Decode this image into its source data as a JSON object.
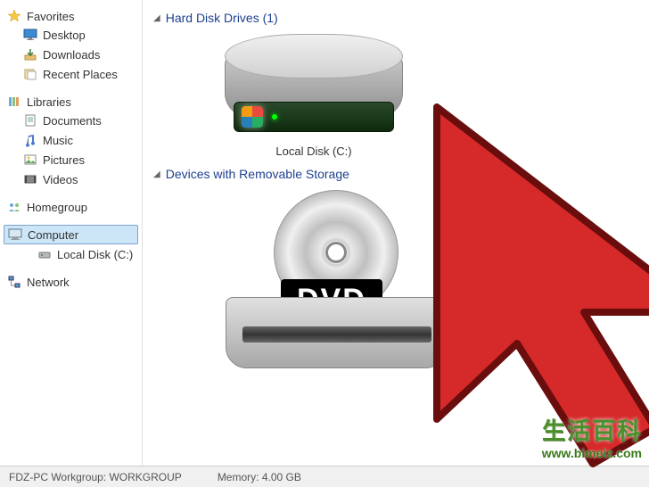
{
  "sidebar": {
    "favorites": {
      "label": "Favorites",
      "items": [
        {
          "label": "Desktop"
        },
        {
          "label": "Downloads"
        },
        {
          "label": "Recent Places"
        }
      ]
    },
    "libraries": {
      "label": "Libraries",
      "items": [
        {
          "label": "Documents"
        },
        {
          "label": "Music"
        },
        {
          "label": "Pictures"
        },
        {
          "label": "Videos"
        }
      ]
    },
    "homegroup": {
      "label": "Homegroup"
    },
    "computer": {
      "label": "Computer",
      "items": [
        {
          "label": "Local Disk (C:)"
        }
      ]
    },
    "network": {
      "label": "Network"
    }
  },
  "content": {
    "hdd_section": "Hard Disk Drives (1)",
    "local_disk_label": "Local Disk (C:)",
    "removable_section": "Devices with Removable Storage",
    "dvd_text": "DVD"
  },
  "statusbar": {
    "workgroup": "FDZ-PC  Workgroup: WORKGROUP",
    "memory": "Memory: 4.00 GB"
  },
  "watermark": {
    "title": "生活百科",
    "url": "www.bimeiz.com"
  },
  "colors": {
    "link_blue": "#1e3f8f",
    "cursor_red": "#d62a2a"
  }
}
